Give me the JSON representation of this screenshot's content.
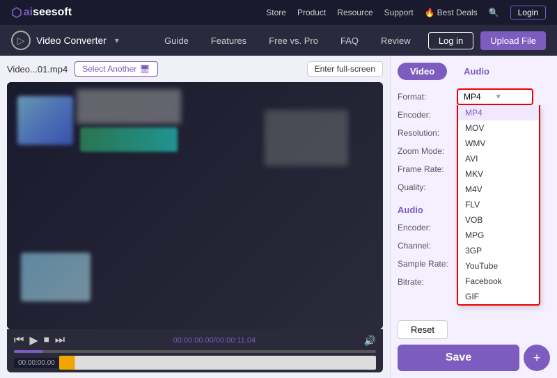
{
  "topnav": {
    "logo_ai": "ai",
    "logo_rest": "seesoft",
    "links": [
      "Store",
      "Product",
      "Resource",
      "Support",
      "Best Deals"
    ],
    "login_label": "Login"
  },
  "subnav": {
    "brand_label": "Video Converter",
    "links": [
      "Guide",
      "Features",
      "Free vs. Pro",
      "FAQ",
      "Review"
    ],
    "login_label": "Log in",
    "upload_label": "Upload File"
  },
  "filebar": {
    "filename": "Video...01.mp4",
    "select_another": "Select Another",
    "enter_fullscreen": "Enter full-screen"
  },
  "videocontrols": {
    "time_current": "00:00:00.00",
    "time_total": "00:00:11.04"
  },
  "righpanel": {
    "tab_video": "Video",
    "tab_audio": "Audio",
    "format_label": "Format:",
    "encoder_label": "Encoder:",
    "resolution_label": "Resolution:",
    "zoom_mode_label": "Zoom Mode:",
    "frame_rate_label": "Frame Rate:",
    "quality_label": "Quality:",
    "audio_header": "Audio",
    "audio_encoder_label": "Encoder:",
    "channel_label": "Channel:",
    "sample_rate_label": "Sample Rate:",
    "bitrate_label": "Bitrate:",
    "format_selected": "MP4",
    "dropdown_items": [
      "MP4",
      "MOV",
      "WMV",
      "AVI",
      "MKV",
      "M4V",
      "FLV",
      "VOB",
      "MPG",
      "3GP",
      "YouTube",
      "Facebook",
      "GIF"
    ],
    "reset_label": "Reset",
    "save_label": "Save",
    "save_plus": "+"
  }
}
